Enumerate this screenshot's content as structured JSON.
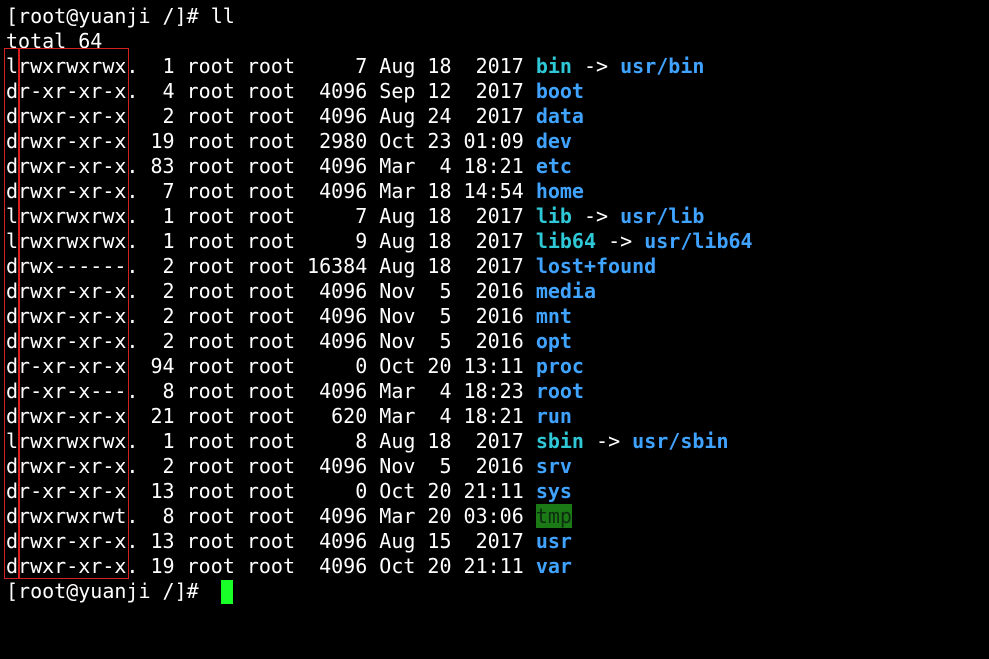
{
  "prompt_line": "[root@yuanji /]# ll",
  "total_line": "total 64",
  "entries": [
    {
      "meta": "lrwxrwxrwx.  1 root root     7 Aug 18  2017 ",
      "name": "bin",
      "arrow": " -> ",
      "target": "usr/bin",
      "kind": "link"
    },
    {
      "meta": "dr-xr-xr-x.  4 root root  4096 Sep 12  2017 ",
      "name": "boot",
      "kind": "dir"
    },
    {
      "meta": "drwxr-xr-x   2 root root  4096 Aug 24  2017 ",
      "name": "data",
      "kind": "dir"
    },
    {
      "meta": "drwxr-xr-x  19 root root  2980 Oct 23 01:09 ",
      "name": "dev",
      "kind": "dir"
    },
    {
      "meta": "drwxr-xr-x. 83 root root  4096 Mar  4 18:21 ",
      "name": "etc",
      "kind": "dir"
    },
    {
      "meta": "drwxr-xr-x.  7 root root  4096 Mar 18 14:54 ",
      "name": "home",
      "kind": "dir"
    },
    {
      "meta": "lrwxrwxrwx.  1 root root     7 Aug 18  2017 ",
      "name": "lib",
      "arrow": " -> ",
      "target": "usr/lib",
      "kind": "link"
    },
    {
      "meta": "lrwxrwxrwx.  1 root root     9 Aug 18  2017 ",
      "name": "lib64",
      "arrow": " -> ",
      "target": "usr/lib64",
      "kind": "link"
    },
    {
      "meta": "drwx------.  2 root root 16384 Aug 18  2017 ",
      "name": "lost+found",
      "kind": "dir"
    },
    {
      "meta": "drwxr-xr-x.  2 root root  4096 Nov  5  2016 ",
      "name": "media",
      "kind": "dir"
    },
    {
      "meta": "drwxr-xr-x.  2 root root  4096 Nov  5  2016 ",
      "name": "mnt",
      "kind": "dir"
    },
    {
      "meta": "drwxr-xr-x.  2 root root  4096 Nov  5  2016 ",
      "name": "opt",
      "kind": "dir"
    },
    {
      "meta": "dr-xr-xr-x  94 root root     0 Oct 20 13:11 ",
      "name": "proc",
      "kind": "dir"
    },
    {
      "meta": "dr-xr-x---.  8 root root  4096 Mar  4 18:23 ",
      "name": "root",
      "kind": "dir"
    },
    {
      "meta": "drwxr-xr-x  21 root root   620 Mar  4 18:21 ",
      "name": "run",
      "kind": "dir"
    },
    {
      "meta": "lrwxrwxrwx.  1 root root     8 Aug 18  2017 ",
      "name": "sbin",
      "arrow": " -> ",
      "target": "usr/sbin",
      "kind": "link"
    },
    {
      "meta": "drwxr-xr-x.  2 root root  4096 Nov  5  2016 ",
      "name": "srv",
      "kind": "dir"
    },
    {
      "meta": "dr-xr-xr-x  13 root root     0 Oct 20 21:11 ",
      "name": "sys",
      "kind": "dir"
    },
    {
      "meta": "drwxrwxrwt.  8 root root  4096 Mar 20 03:06 ",
      "name": "tmp",
      "kind": "sticky"
    },
    {
      "meta": "drwxr-xr-x. 13 root root  4096 Aug 15  2017 ",
      "name": "usr",
      "kind": "dir"
    },
    {
      "meta": "drwxr-xr-x. 19 root root  4096 Oct 20 21:11 ",
      "name": "var",
      "kind": "dir"
    }
  ],
  "final_prompt": "[root@yuanji /]# ",
  "colors": {
    "background": "#000000",
    "text": "#ffffff",
    "link": "#2ec8d7",
    "directory": "#3fa3ff",
    "sticky_bg": "#1b7a15",
    "cursor": "#19ff28",
    "highlight_box": "#d92020"
  }
}
